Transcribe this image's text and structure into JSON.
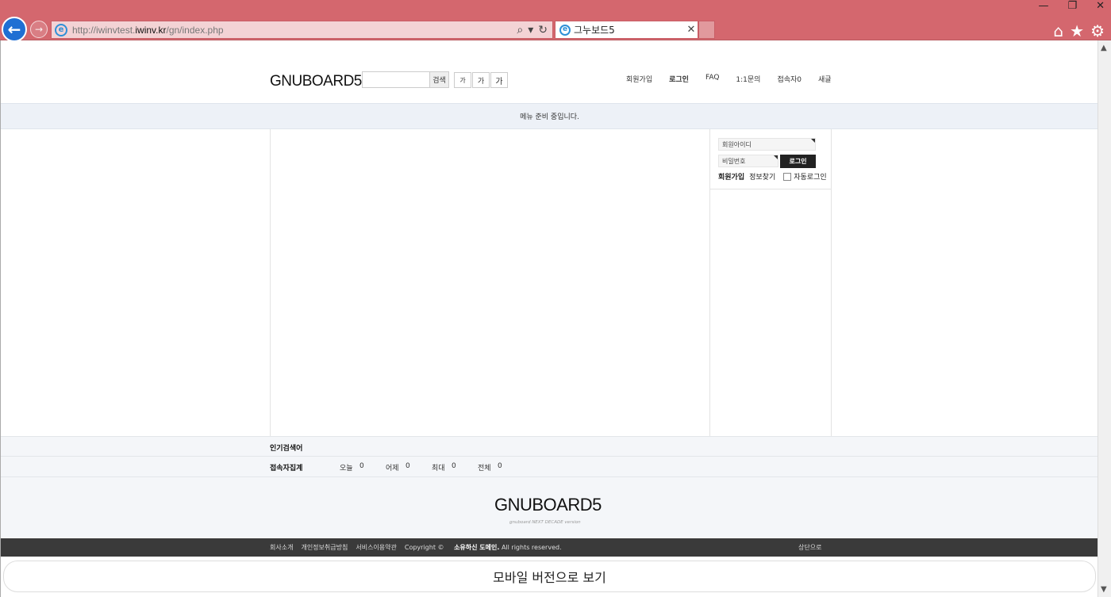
{
  "browser": {
    "url_prefix": "http://iwinvtest.",
    "url_domain": "iwinv.kr",
    "url_path": "/gn/index.php",
    "tab_title": "그누보드5",
    "ie_glyph": "e",
    "back_glyph": "←",
    "forward_glyph": "→",
    "search_glyph": "⌕",
    "dropdown_glyph": "▾",
    "refresh_glyph": "↻",
    "close_glyph": "✕",
    "minimize_glyph": "—",
    "maximize_glyph": "❐",
    "window_close_glyph": "✕",
    "home_glyph": "⌂",
    "favorites_glyph": "★",
    "settings_glyph": "⚙"
  },
  "header": {
    "logo": "GNUBOARD5",
    "search_button": "검색",
    "font_small": "가",
    "font_medium": "가",
    "font_large": "가",
    "nav": [
      "회원가입",
      "로그인",
      "FAQ",
      "1:1문의",
      "접속자0",
      "새글"
    ]
  },
  "notice": "메뉴 준비 중입니다.",
  "login": {
    "id_placeholder": "회원아이디",
    "pw_placeholder": "비밀번호",
    "login_button": "로그인",
    "join_link": "회원가입",
    "find_link": "정보찾기",
    "auto_login": "자동로그인"
  },
  "popular": {
    "title": "인기검색어"
  },
  "visit": {
    "title": "접속자집계",
    "today_label": "오늘",
    "today_value": "0",
    "yesterday_label": "어제",
    "yesterday_value": "0",
    "max_label": "최대",
    "max_value": "0",
    "total_label": "전체",
    "total_value": "0"
  },
  "footer": {
    "logo": "GNUBOARD5",
    "tagline": "gnuboard NEXT DECADE version",
    "links": [
      "회사소개",
      "개인정보취급방침",
      "서비스이용약관"
    ],
    "copyright_prefix": "Copyright ©",
    "copyright_owner": "소유하신 도메인.",
    "copyright_suffix": "All rights reserved.",
    "to_top": "상단으로"
  },
  "mobile_view": "모바일 버전으로 보기",
  "scroll_up": "▲",
  "scroll_down": "▼"
}
